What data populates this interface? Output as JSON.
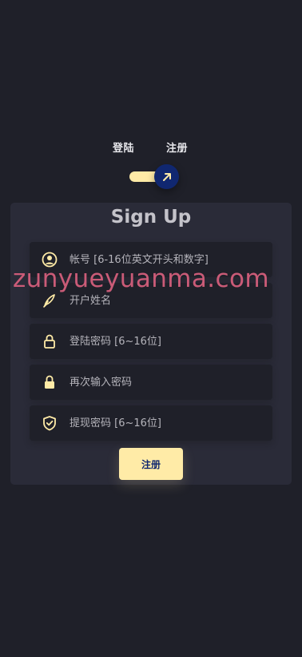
{
  "tabs": {
    "login_label": "登陆",
    "register_label": "注册"
  },
  "toggle": {
    "state": "on",
    "track_color": "#ffeba7",
    "knob_color": "#102770",
    "icon": "arrow-up-right-icon"
  },
  "form": {
    "title": "Sign Up",
    "fields": [
      {
        "icon": "user-circle-icon",
        "placeholder": "帐号 [6-16位英文开头和数字]",
        "value": ""
      },
      {
        "icon": "pen-icon",
        "placeholder": "开户姓名",
        "value": ""
      },
      {
        "icon": "lock-open-icon",
        "placeholder": "登陆密码 [6~16位]",
        "value": ""
      },
      {
        "icon": "lock-icon",
        "placeholder": "再次输入密码",
        "value": ""
      },
      {
        "icon": "shield-check-icon",
        "placeholder": "提现密码 [6~16位]",
        "value": ""
      }
    ],
    "submit_label": "注册"
  },
  "watermark": "zunyueyuanma.com",
  "colors": {
    "background": "#1f2029",
    "card": "#2a2b38",
    "accent": "#ffeba7",
    "accent_dark": "#102770",
    "text": "#c4c3ca"
  }
}
